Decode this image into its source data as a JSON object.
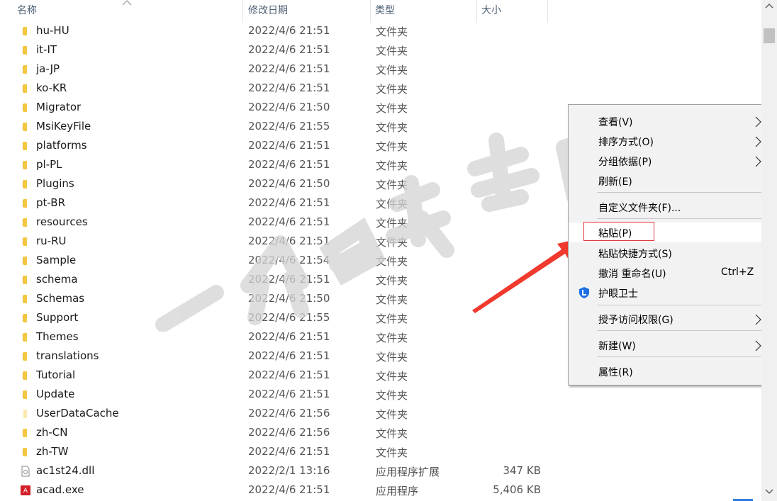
{
  "columns": {
    "name": "名称",
    "date": "修改日期",
    "type": "类型",
    "size": "大小"
  },
  "rows": [
    {
      "name": "hu-HU",
      "date": "2022/4/6 21:51",
      "type": "文件夹",
      "size": "",
      "icon": "folder-icon"
    },
    {
      "name": "it-IT",
      "date": "2022/4/6 21:51",
      "type": "文件夹",
      "size": "",
      "icon": "folder-icon"
    },
    {
      "name": "ja-JP",
      "date": "2022/4/6 21:51",
      "type": "文件夹",
      "size": "",
      "icon": "folder-icon"
    },
    {
      "name": "ko-KR",
      "date": "2022/4/6 21:51",
      "type": "文件夹",
      "size": "",
      "icon": "folder-icon"
    },
    {
      "name": "Migrator",
      "date": "2022/4/6 21:50",
      "type": "文件夹",
      "size": "",
      "icon": "folder-icon"
    },
    {
      "name": "MsiKeyFile",
      "date": "2022/4/6 21:55",
      "type": "文件夹",
      "size": "",
      "icon": "folder-icon"
    },
    {
      "name": "platforms",
      "date": "2022/4/6 21:51",
      "type": "文件夹",
      "size": "",
      "icon": "folder-icon"
    },
    {
      "name": "pl-PL",
      "date": "2022/4/6 21:51",
      "type": "文件夹",
      "size": "",
      "icon": "folder-icon"
    },
    {
      "name": "Plugins",
      "date": "2022/4/6 21:50",
      "type": "文件夹",
      "size": "",
      "icon": "folder-icon"
    },
    {
      "name": "pt-BR",
      "date": "2022/4/6 21:51",
      "type": "文件夹",
      "size": "",
      "icon": "folder-icon"
    },
    {
      "name": "resources",
      "date": "2022/4/6 21:51",
      "type": "文件夹",
      "size": "",
      "icon": "folder-icon"
    },
    {
      "name": "ru-RU",
      "date": "2022/4/6 21:51",
      "type": "文件夹",
      "size": "",
      "icon": "folder-icon"
    },
    {
      "name": "Sample",
      "date": "2022/4/6 21:54",
      "type": "文件夹",
      "size": "",
      "icon": "folder-icon"
    },
    {
      "name": "schema",
      "date": "2022/4/6 21:51",
      "type": "文件夹",
      "size": "",
      "icon": "folder-icon"
    },
    {
      "name": "Schemas",
      "date": "2022/4/6 21:50",
      "type": "文件夹",
      "size": "",
      "icon": "folder-icon"
    },
    {
      "name": "Support",
      "date": "2022/4/6 21:55",
      "type": "文件夹",
      "size": "",
      "icon": "folder-icon"
    },
    {
      "name": "Themes",
      "date": "2022/4/6 21:51",
      "type": "文件夹",
      "size": "",
      "icon": "folder-icon"
    },
    {
      "name": "translations",
      "date": "2022/4/6 21:51",
      "type": "文件夹",
      "size": "",
      "icon": "folder-icon"
    },
    {
      "name": "Tutorial",
      "date": "2022/4/6 21:51",
      "type": "文件夹",
      "size": "",
      "icon": "folder-icon"
    },
    {
      "name": "Update",
      "date": "2022/4/6 21:51",
      "type": "文件夹",
      "size": "",
      "icon": "folder-icon"
    },
    {
      "name": "UserDataCache",
      "date": "2022/4/6 21:56",
      "type": "文件夹",
      "size": "",
      "icon": "folder-light-icon"
    },
    {
      "name": "zh-CN",
      "date": "2022/4/6 21:56",
      "type": "文件夹",
      "size": "",
      "icon": "folder-icon"
    },
    {
      "name": "zh-TW",
      "date": "2022/4/6 21:51",
      "type": "文件夹",
      "size": "",
      "icon": "folder-icon"
    },
    {
      "name": "ac1st24.dll",
      "date": "2022/2/1 13:16",
      "type": "应用程序扩展",
      "size": "347 KB",
      "icon": "dll-file-icon"
    },
    {
      "name": "acad.exe",
      "date": "2022/4/6 21:51",
      "type": "应用程序",
      "size": "5,406 KB",
      "icon": "autocad-app-icon"
    }
  ],
  "context_menu": {
    "view": "查看(V)",
    "sort": "排序方式(O)",
    "group": "分组依据(P)",
    "refresh": "刷新(E)",
    "customize": "自定义文件夹(F)...",
    "paste": "粘贴(P)",
    "paste_shortcut": "粘贴快捷方式(S)",
    "undo": "撤消 重命名(U)",
    "undo_shortcut": "Ctrl+Z",
    "eye_guard": "护眼卫士",
    "grant_access": "授予访问权限(G)",
    "new": "新建(W)",
    "properties": "属性(R)"
  },
  "colors": {
    "folder": "#f5c842",
    "highlight_border": "#e0363a",
    "arrow": "#f03a2e",
    "accent": "#2f7fe0"
  }
}
